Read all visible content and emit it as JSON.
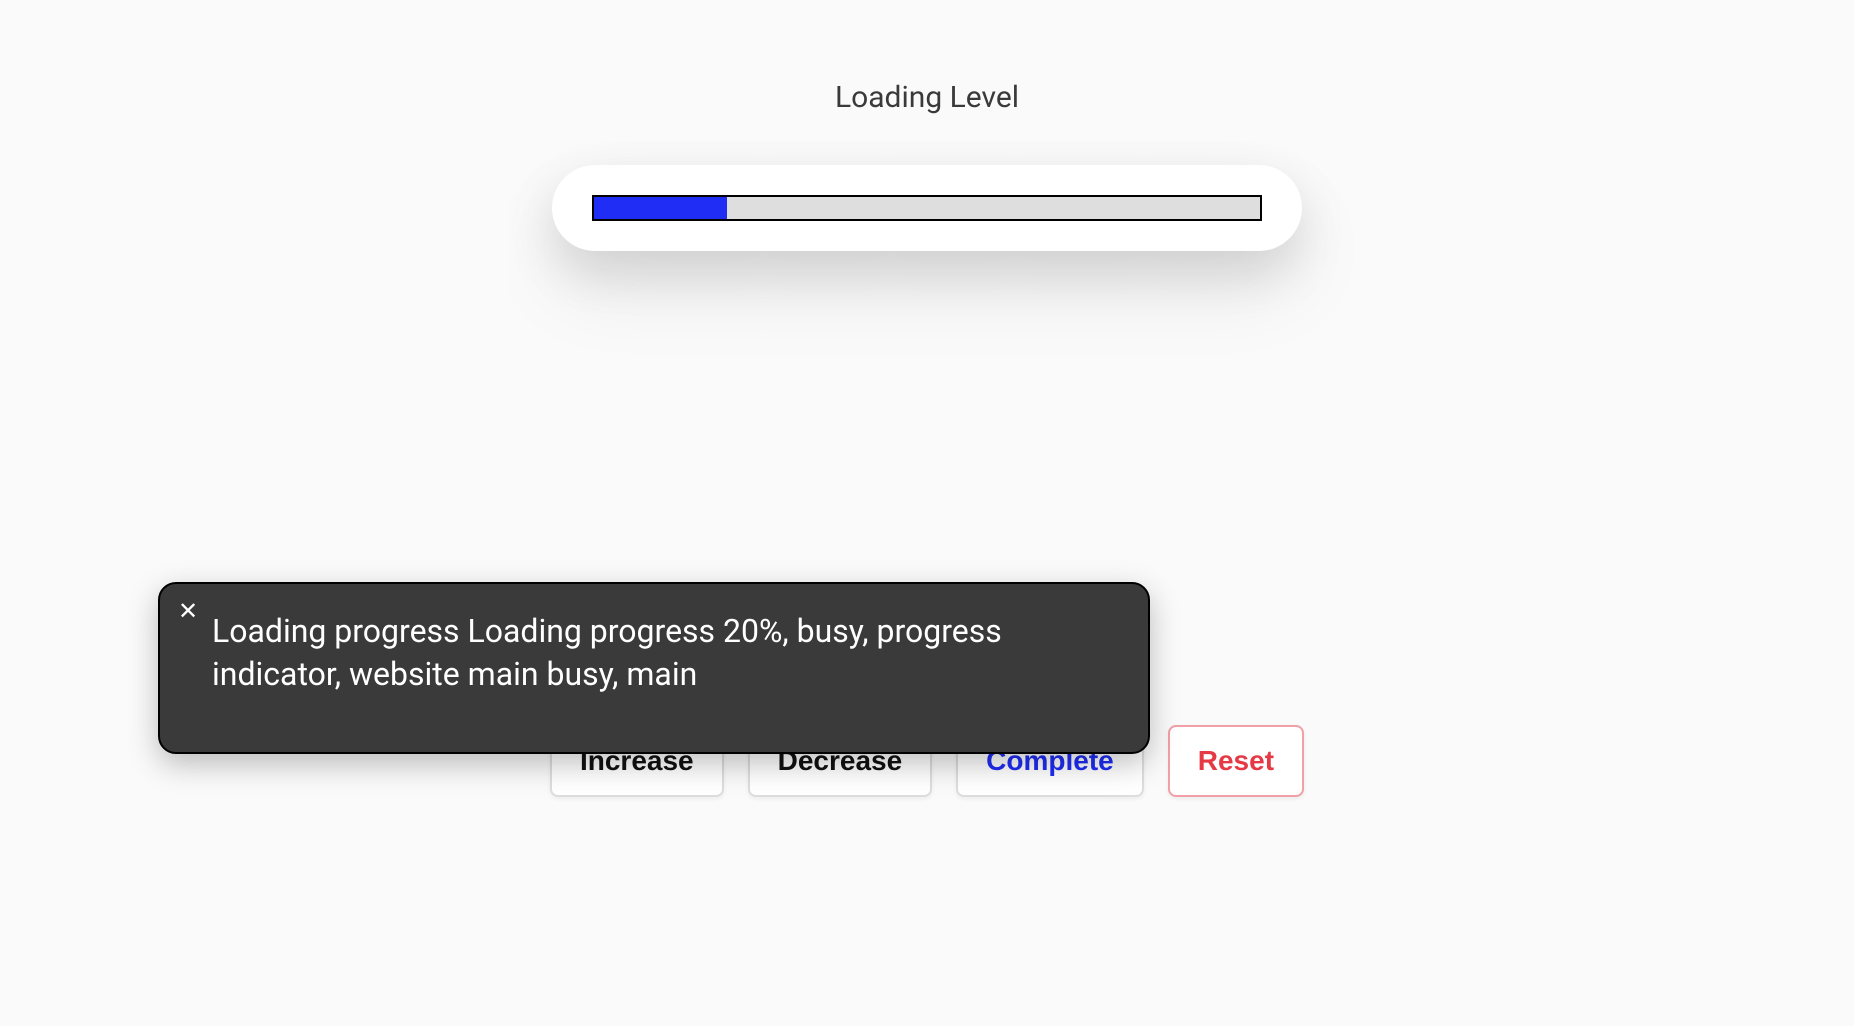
{
  "heading": "Loading Level",
  "progress": {
    "percent": 20
  },
  "buttons": {
    "increase": "Increase",
    "decrease": "Decrease",
    "complete": "Complete",
    "reset": "Reset"
  },
  "tooltip": {
    "text": "Loading progress Loading progress 20%, busy, progress indicator, website main busy, main"
  }
}
